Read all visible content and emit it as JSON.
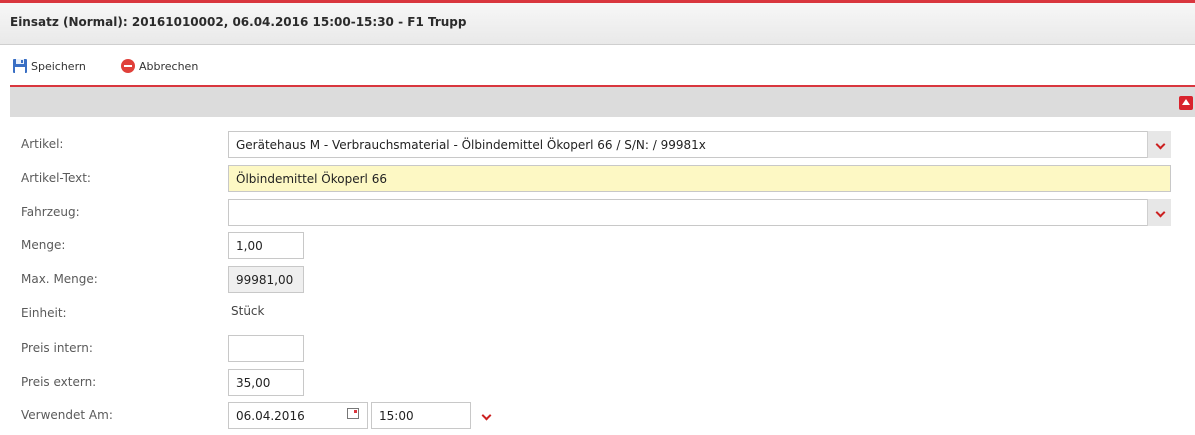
{
  "window": {
    "title": "Einsatz (Normal): 20161010002, 06.04.2016 15:00-15:30 - F1 Trupp"
  },
  "toolbar": {
    "save_label": "Speichern",
    "cancel_label": "Abbrechen"
  },
  "form": {
    "artikel": {
      "label": "Artikel:",
      "value": "Gerätehaus M - Verbrauchsmaterial - Ölbindemittel Ökoperl 66 / S/N:  / 99981x"
    },
    "artikel_text": {
      "label": "Artikel-Text:",
      "value": "Ölbindemittel Ökoperl 66"
    },
    "fahrzeug": {
      "label": "Fahrzeug:",
      "value": ""
    },
    "menge": {
      "label": "Menge:",
      "value": "1,00"
    },
    "max_menge": {
      "label": "Max. Menge:",
      "value": "99981,00"
    },
    "einheit": {
      "label": "Einheit:",
      "value": "Stück"
    },
    "preis_intern": {
      "label": "Preis intern:",
      "value": ""
    },
    "preis_extern": {
      "label": "Preis extern:",
      "value": "35,00"
    },
    "verwendet_am": {
      "label": "Verwendet Am:",
      "date": "06.04.2016",
      "time": "15:00"
    }
  },
  "colors": {
    "accent_red": "#d9363e",
    "highlight_yellow": "#fdf8c4"
  },
  "icons": {
    "save": "floppy-disk-icon",
    "cancel": "red-circle-minus-icon",
    "collapse": "collapse-up-icon",
    "dropdown": "chevron-down-icon",
    "calendar": "calendar-icon"
  }
}
